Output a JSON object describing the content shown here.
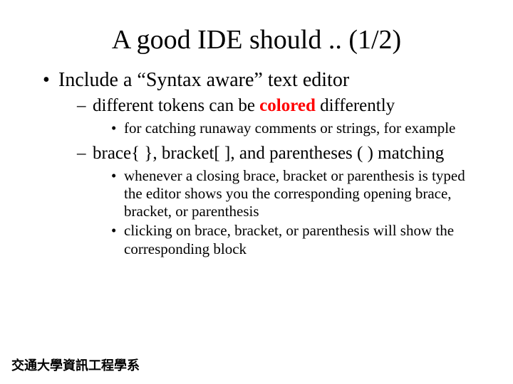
{
  "title": "A good IDE should ..  (1/2)",
  "bullets": {
    "l1": "Include a “Syntax aware” text editor",
    "l2a_pre": "different tokens can be ",
    "l2a_colored": "colored",
    "l2a_post": " differently",
    "l3a": "for catching runaway comments or strings, for example",
    "l2b": " brace{ }, bracket[ ], and parentheses ( ) matching",
    "l3b": "whenever a closing brace, bracket or parenthesis is typed the editor shows you the corresponding opening brace, bracket, or parenthesis",
    "l3c": "clicking on brace, bracket, or parenthesis will show the corresponding block"
  },
  "footer": "交通大學資訊工程學系"
}
